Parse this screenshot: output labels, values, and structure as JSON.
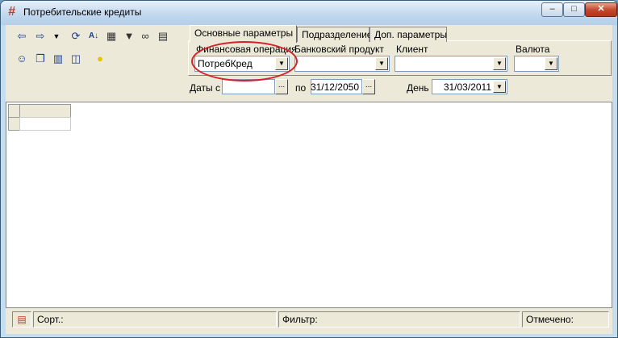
{
  "window": {
    "title": "Потребительские кредиты",
    "controls": {
      "minimize": "–",
      "maximize": "□",
      "close": "✕"
    }
  },
  "toolbar": {
    "icons": [
      "arrow-left-icon",
      "arrow-right-icon",
      "dropdown-arrow-icon",
      "refresh-icon",
      "sort-az-icon",
      "tools-icon",
      "filter-icon",
      "binoculars-icon",
      "print-icon",
      "user-settings-icon",
      "copy-icon",
      "notes-icon",
      "pages-icon",
      "lightbulb-icon"
    ]
  },
  "tabs": [
    {
      "label": "Основные параметры",
      "active": true
    },
    {
      "label": "Подразделение",
      "active": false
    },
    {
      "label": "Доп. параметры",
      "active": false
    }
  ],
  "filters": {
    "fin_op_label": "Финансовая операция",
    "fin_op_value": "ПотребКред",
    "product_label": "Банковский продукт",
    "product_value": "",
    "client_label": "Клиент",
    "client_value": "",
    "currency_label": "Валюта",
    "currency_value": ""
  },
  "dates": {
    "from_label": "Даты с",
    "from_value": "",
    "to_label": "по",
    "to_value": "31/12/2050",
    "day_label": "День",
    "day_value": "31/03/2011",
    "browse_label": "..."
  },
  "statusbar": {
    "sort_label": "Сорт.:",
    "filter_label": "Фильтр:",
    "marked_label": "Отмечено:"
  },
  "colors": {
    "highlight": "#d6202a",
    "title_icon": "#c0392b"
  }
}
